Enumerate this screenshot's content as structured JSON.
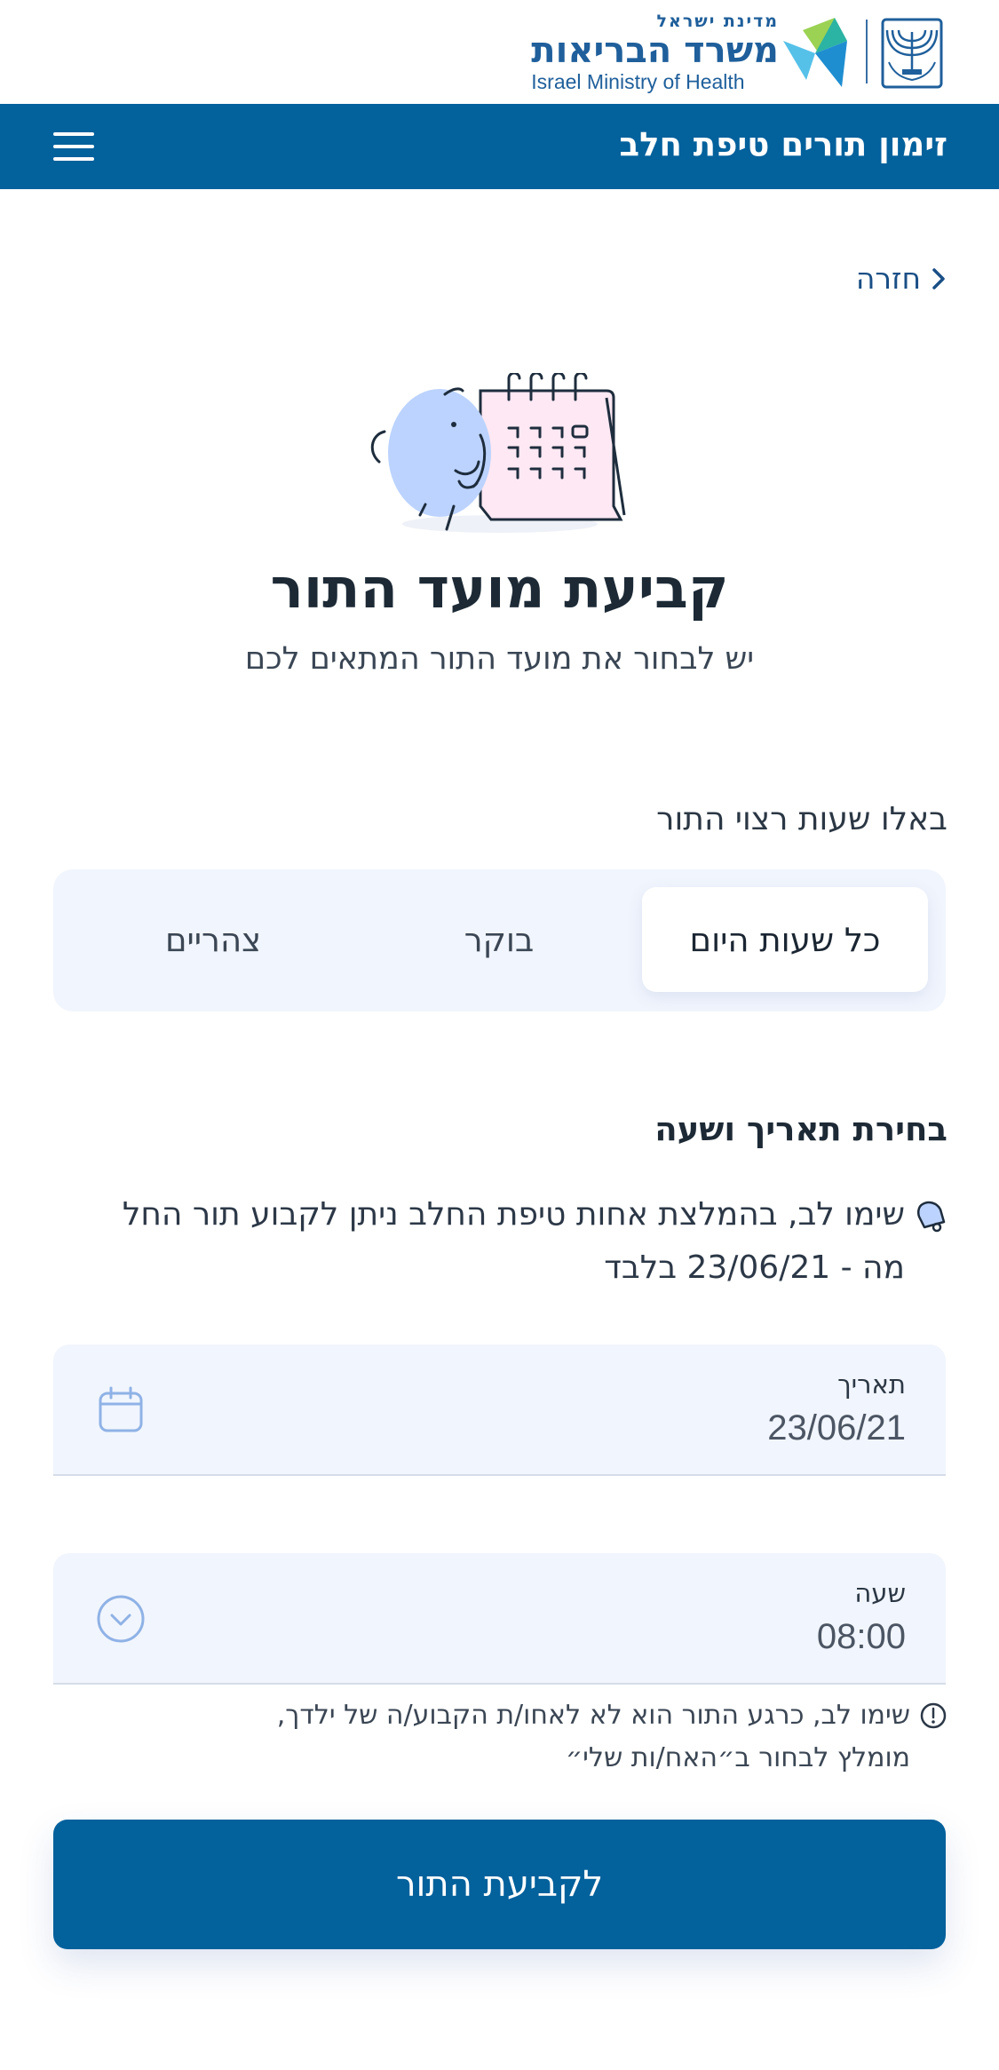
{
  "logo": {
    "state_name": "מדינת ישראל",
    "ministry_name": "משרד הבריאות",
    "ministry_name_en": "Israel Ministry of Health",
    "emblem_icon": "menorah-emblem-icon",
    "bird_icon": "ministry-bird-logo-icon"
  },
  "header": {
    "title": "זימון תורים טיפת חלב",
    "menu_icon": "hamburger-menu-icon"
  },
  "back": {
    "label": "חזרה",
    "icon": "chevron-right-icon"
  },
  "intro": {
    "illustration": "egg-and-calendar-illustration",
    "title": "קביעת מועד התור",
    "subtitle": "יש לבחור את מועד התור המתאים לכם"
  },
  "hours": {
    "label": "באלו שעות רצוי התור",
    "options": [
      "כל שעות היום",
      "בוקר",
      "צהריים"
    ],
    "selected": "כל שעות היום"
  },
  "date_time": {
    "heading": "בחירת תאריך ושעה",
    "notice_icon": "bell-icon",
    "notice_line1": "שימו לב, בהמלצת אחות טיפת החלב ניתן לקבוע תור החל",
    "notice_line2": "מה - 23/06/21 בלבד",
    "date_label": "תאריך",
    "date_value": "23/06/21",
    "date_icon": "calendar-icon",
    "time_label": "שעה",
    "time_value": "08:00",
    "time_icon": "chevron-down-circle-icon"
  },
  "hint": {
    "icon": "info-circle-icon",
    "line1": "שימו לב, כרגע התור הוא לא לאחו/ת הקבוע/ה של ילדך,",
    "line2": "מומלץ לבחור ב״האח/ות שלי״"
  },
  "submit": {
    "label": "לקביעת התור"
  },
  "colors": {
    "primary": "#03619c",
    "field_bg": "#f1f5fd",
    "accent_blue": "#bcd3ff",
    "accent_pink": "#fde8f3"
  }
}
